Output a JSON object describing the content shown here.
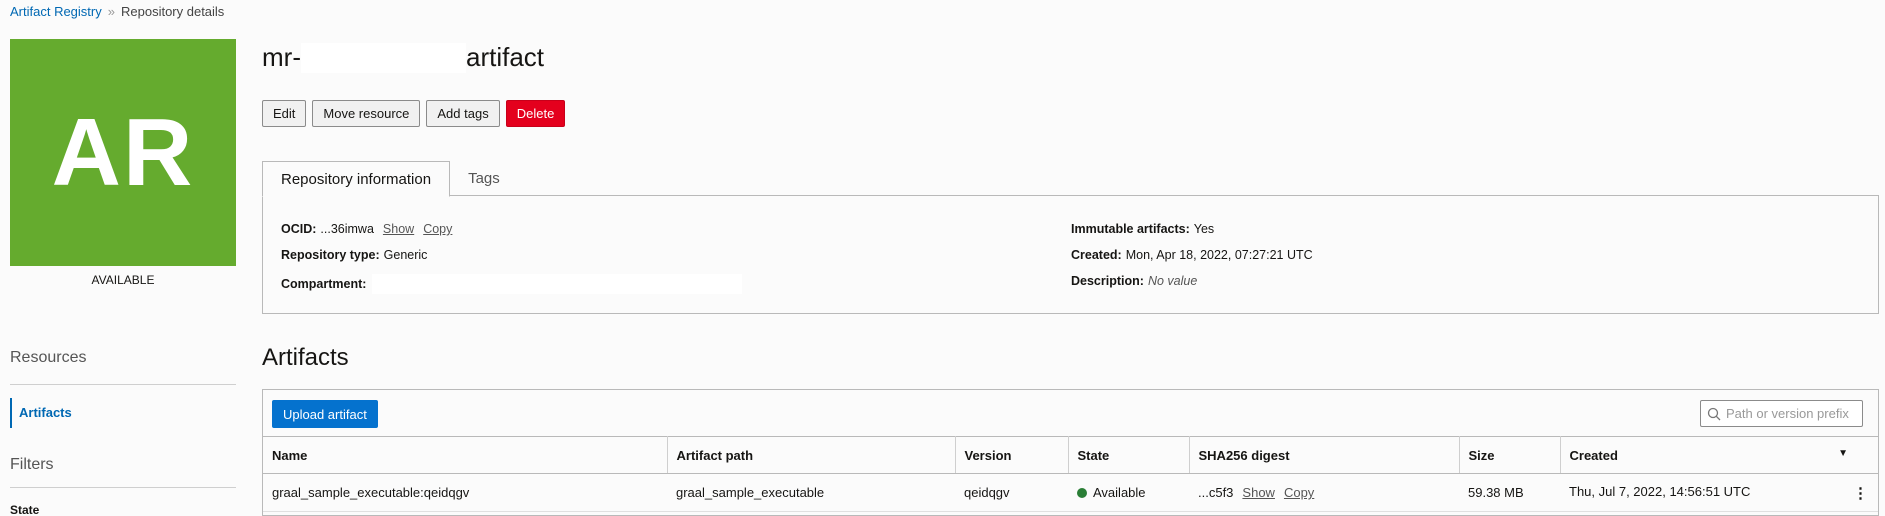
{
  "breadcrumb": {
    "root": "Artifact Registry",
    "separator": "»",
    "current": "Repository details"
  },
  "avatar": {
    "initials": "AR",
    "status": "AVAILABLE",
    "color": "#65ab2e"
  },
  "title": {
    "prefix": "mr-",
    "suffix": "artifact"
  },
  "actions": {
    "edit": "Edit",
    "move": "Move resource",
    "add_tags": "Add tags",
    "delete": "Delete"
  },
  "tabs": {
    "repo_info": "Repository information",
    "tags": "Tags"
  },
  "info": {
    "ocid_label": "OCID:",
    "ocid_value": "...36imwa",
    "show": "Show",
    "copy": "Copy",
    "repo_type_label": "Repository type:",
    "repo_type_value": "Generic",
    "compartment_label": "Compartment:",
    "immutable_label": "Immutable artifacts:",
    "immutable_value": "Yes",
    "created_label": "Created:",
    "created_value": "Mon, Apr 18, 2022, 07:27:21 UTC",
    "description_label": "Description:",
    "description_value": "No value"
  },
  "sidebar": {
    "resources_heading": "Resources",
    "artifacts_item": "Artifacts",
    "filters_heading": "Filters",
    "state_label": "State"
  },
  "artifacts": {
    "title": "Artifacts",
    "upload_button": "Upload artifact",
    "search_placeholder": "Path or version prefix",
    "columns": [
      "Name",
      "Artifact path",
      "Version",
      "State",
      "SHA256 digest",
      "Size",
      "Created"
    ],
    "rows": [
      {
        "name": "graal_sample_executable:qeidqgv",
        "path": "graal_sample_executable",
        "version": "qeidqgv",
        "state": "Available",
        "digest": "...c5f3",
        "show": "Show",
        "copy": "Copy",
        "size": "59.38 MB",
        "created": "Thu, Jul 7, 2022, 14:56:51 UTC"
      }
    ]
  },
  "colors": {
    "accent": "#0572ce",
    "danger": "#e4001d",
    "available": "#2a7e36"
  }
}
